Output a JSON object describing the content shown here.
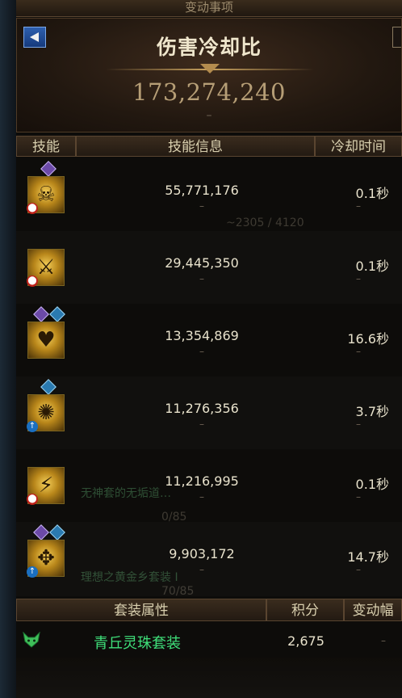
{
  "window": {
    "top_title": "变动事项"
  },
  "header": {
    "title": "伤害冷却比",
    "value": "173,274,240",
    "dash": "–"
  },
  "columns": {
    "skill": "技能",
    "info": "技能信息",
    "cooldown": "冷却时间"
  },
  "skills": [
    {
      "damage": "55,771,176",
      "cooldown": "0.1秒",
      "dash": "–",
      "icon": "skull-skill-icon",
      "badges": [
        "purple"
      ],
      "corner": "red"
    },
    {
      "damage": "29,445,350",
      "cooldown": "0.1秒",
      "dash": "–",
      "icon": "blade-skill-icon",
      "badges": [],
      "corner": "red"
    },
    {
      "damage": "13,354,869",
      "cooldown": "16.6秒",
      "dash": "–",
      "icon": "heart-skill-icon",
      "badges": [
        "purple",
        "blue"
      ],
      "corner": ""
    },
    {
      "damage": "11,276,356",
      "cooldown": "3.7秒",
      "dash": "–",
      "icon": "spiral-skill-icon",
      "badges": [
        "blue"
      ],
      "corner": "blue"
    },
    {
      "damage": "11,216,995",
      "cooldown": "0.1秒",
      "dash": "–",
      "icon": "sword-skill-icon",
      "badges": [],
      "corner": "red"
    },
    {
      "damage": "9,903,172",
      "cooldown": "14.7秒",
      "dash": "–",
      "icon": "beast-skill-icon",
      "badges": [
        "purple",
        "blue"
      ],
      "corner": "blue"
    }
  ],
  "set_columns": {
    "attribute": "套装属性",
    "score": "积分",
    "change": "变动幅"
  },
  "set_row": {
    "name": "青丘灵珠套装",
    "score": "2,675",
    "change": "–",
    "icon": "fox-icon"
  },
  "colors": {
    "accent_gold": "#c8a25e",
    "set_green": "#3fe07a",
    "text": "#e8e2cc"
  }
}
